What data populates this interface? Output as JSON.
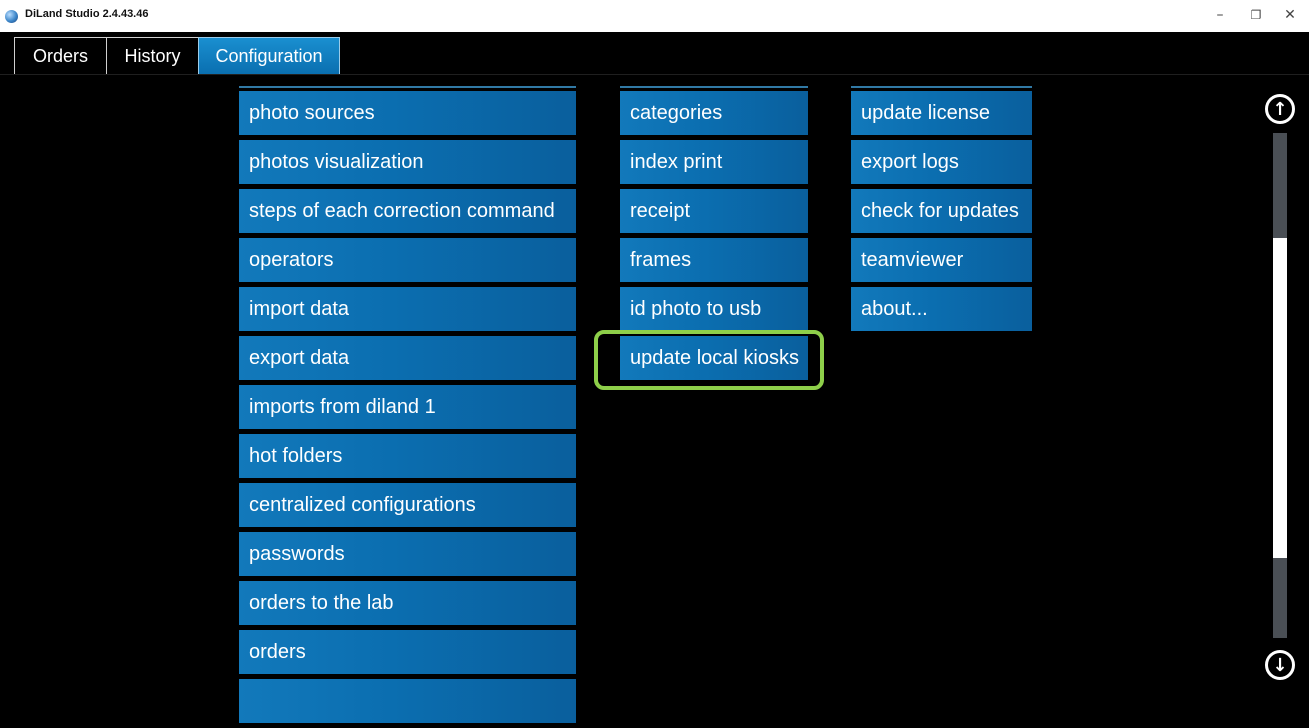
{
  "window": {
    "title": "DiLand Studio 2.4.43.46",
    "min_glyph": "–",
    "max_glyph": "❐",
    "close_glyph": "✕",
    "app_icon": "diland-logo-icon"
  },
  "tabs": [
    {
      "label": "Orders",
      "active": false
    },
    {
      "label": "History",
      "active": false
    },
    {
      "label": "Configuration",
      "active": true
    }
  ],
  "menu": {
    "column1": [
      "photo sources",
      "photos visualization",
      "steps of each correction command",
      "operators",
      "import data",
      "export data",
      "imports from diland 1",
      "hot folders",
      "centralized configurations",
      "passwords",
      "orders to the lab",
      "orders"
    ],
    "column2": [
      "categories",
      "index print",
      "receipt",
      "frames",
      "id photo to usb",
      "update local kiosks"
    ],
    "column3": [
      "update license",
      "export logs",
      "check for updates",
      "teamviewer",
      "about..."
    ]
  },
  "highlight": {
    "target": "update local kiosks",
    "color": "#8ecf4a"
  },
  "scrollbar": {
    "up_glyph": "↑",
    "down_glyph": "↓"
  },
  "colors": {
    "accent": "#0b6eb0",
    "background": "#000000"
  }
}
